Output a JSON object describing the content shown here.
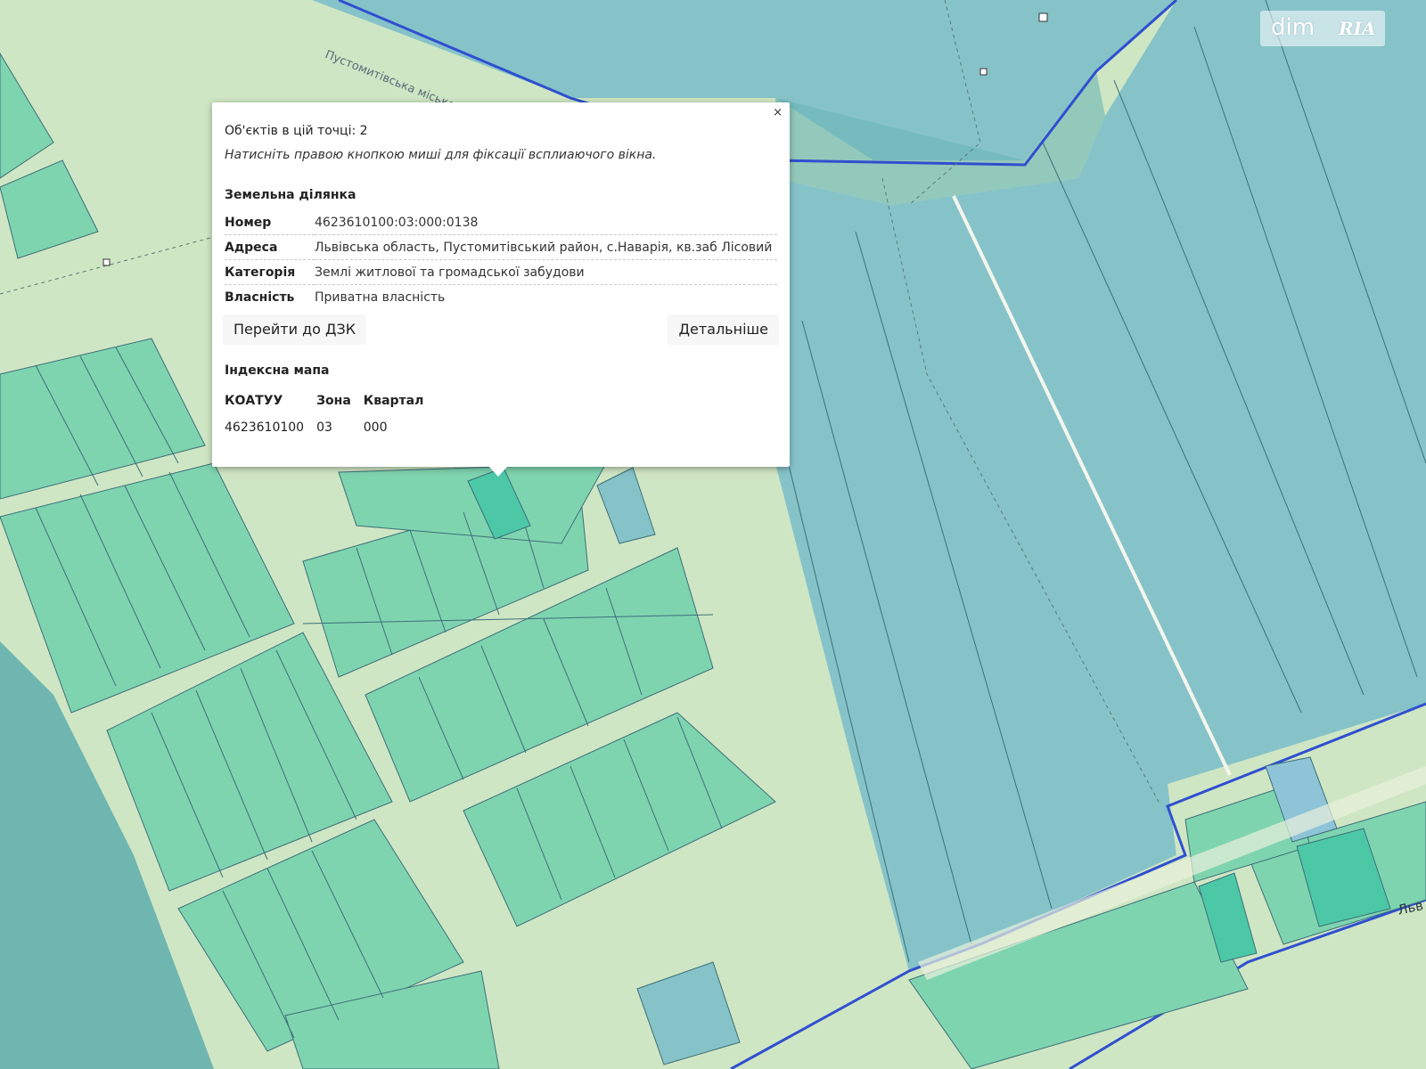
{
  "map": {
    "colors": {
      "background": "#cfe6c4",
      "residential": "#7fd4b0",
      "agricultural": "#86c3c9",
      "forest": "#6fb6b0",
      "boundary": "#2f4fd0",
      "road": "#eaf1dc"
    },
    "road_labels": {
      "community": "Пустомитівська міська громада",
      "street": "Льв"
    }
  },
  "popup": {
    "close_label": "×",
    "objects_count_text": "Об'єктів в цій точці: 2",
    "hint_text": "Натисніть правою кнопкою миші для фіксації всплиаючого вікна.",
    "land_plot": {
      "title": "Земельна ділянка",
      "rows": [
        {
          "key": "Номер",
          "value": "4623610100:03:000:0138"
        },
        {
          "key": "Адреса",
          "value": "Львівська область, Пустомитівський район, с.Наварія, кв.заб Лісовий"
        },
        {
          "key": "Категорія",
          "value": "Землі житлової та громадської забудови"
        },
        {
          "key": "Власність",
          "value": "Приватна власність"
        }
      ]
    },
    "buttons": {
      "go_dzk": "Перейти до ДЗК",
      "details": "Детальніше"
    },
    "index_map": {
      "title": "Індексна мапа",
      "headers": [
        "КОАТУУ",
        "Зона",
        "Квартал"
      ],
      "values": [
        "4623610100",
        "03",
        "000"
      ]
    }
  },
  "watermark": {
    "left": "dim",
    "right": "RIA"
  }
}
